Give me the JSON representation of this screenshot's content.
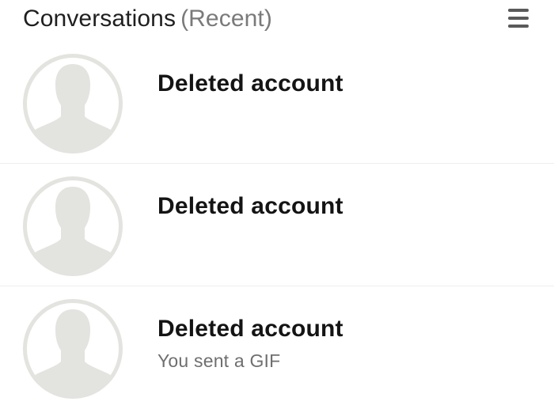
{
  "header": {
    "title": "Conversations",
    "subtitle": "(Recent)",
    "menu_icon": "hamburger-menu-icon"
  },
  "colors": {
    "avatar_gray": "#e3e3df",
    "title_text": "#1f1f1f",
    "subtitle_text": "#7a7a7a",
    "preview_text": "#6f6f6f",
    "divider": "#eeeeee"
  },
  "conversations": [
    {
      "name": "Deleted account",
      "preview": "",
      "avatar_icon": "default-user-avatar-icon"
    },
    {
      "name": "Deleted account",
      "preview": "",
      "avatar_icon": "default-user-avatar-icon"
    },
    {
      "name": "Deleted account",
      "preview": "You sent a GIF",
      "avatar_icon": "default-user-avatar-icon"
    }
  ]
}
